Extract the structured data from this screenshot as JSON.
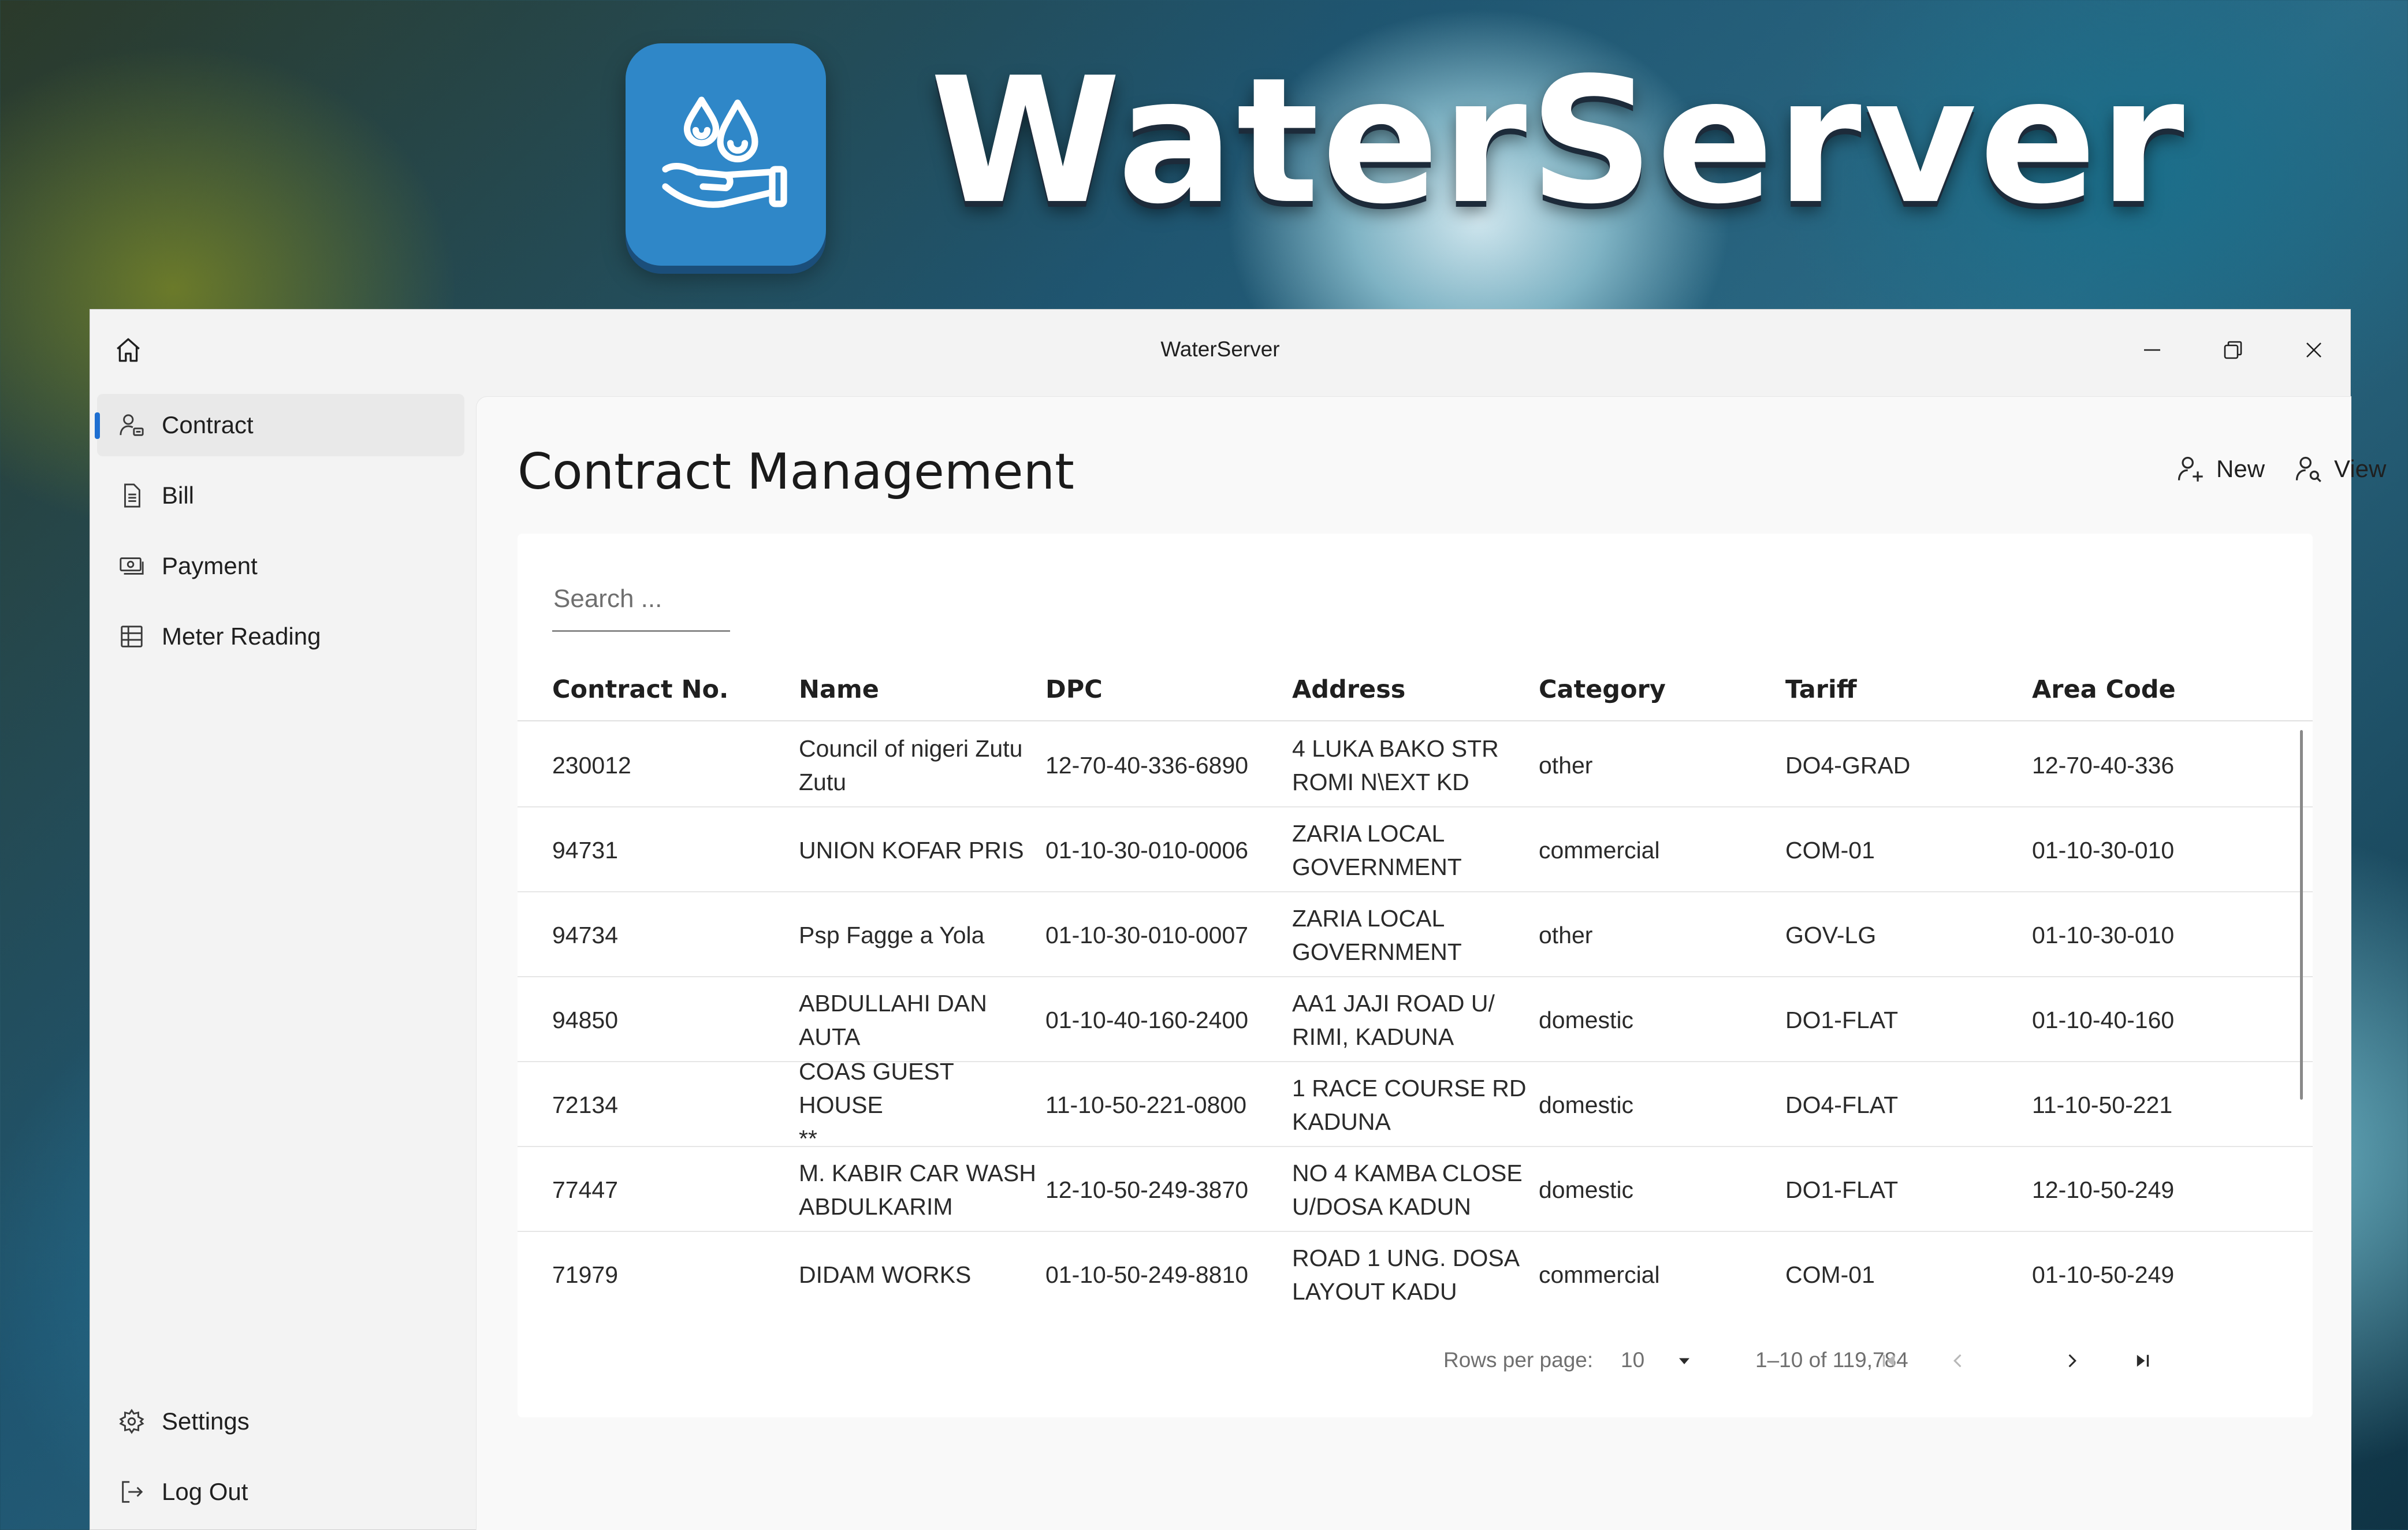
{
  "brand": {
    "name": "WaterServer",
    "logo_icon": "water-hand-icon",
    "logo_color": "#2f87c8"
  },
  "window": {
    "title": "WaterServer",
    "controls": [
      "minimize-icon",
      "restore-icon",
      "close-icon"
    ]
  },
  "sidebar": {
    "top_items": [
      {
        "label": "Contract",
        "icon": "contract-person-icon",
        "active": true
      },
      {
        "label": "Bill",
        "icon": "bill-document-icon",
        "active": false
      },
      {
        "label": "Payment",
        "icon": "payment-cash-icon",
        "active": false
      },
      {
        "label": "Meter Reading",
        "icon": "meter-table-icon",
        "active": false
      }
    ],
    "bottom_items": [
      {
        "label": "Settings",
        "icon": "gear-icon"
      },
      {
        "label": "Log Out",
        "icon": "logout-icon"
      }
    ],
    "accent": "#1f6fd1"
  },
  "main": {
    "title": "Contract Management",
    "actions": {
      "new_label": "New",
      "view_label": "View"
    },
    "search": {
      "placeholder": "Search ..."
    },
    "table": {
      "columns": [
        "Contract No.",
        "Name",
        "DPC",
        "Address",
        "Category",
        "Tariff",
        "Area Code"
      ],
      "rows": [
        {
          "contract_no": "230012",
          "name": [
            "Council of nigeri Zutu",
            "Zutu"
          ],
          "dpc": "12-70-40-336-6890",
          "address": [
            "4 LUKA BAKO STR",
            "ROMI N\\EXT KD"
          ],
          "category": "other",
          "tariff": "DO4-GRAD",
          "area_code": "12-70-40-336"
        },
        {
          "contract_no": "94731",
          "name": [
            "UNION KOFAR PRIS"
          ],
          "dpc": "01-10-30-010-0006",
          "address": [
            "ZARIA LOCAL",
            "GOVERNMENT"
          ],
          "category": "commercial",
          "tariff": "COM-01",
          "area_code": "01-10-30-010"
        },
        {
          "contract_no": "94734",
          "name": [
            "Psp Fagge a Yola"
          ],
          "dpc": "01-10-30-010-0007",
          "address": [
            "ZARIA LOCAL",
            "GOVERNMENT"
          ],
          "category": "other",
          "tariff": "GOV-LG",
          "area_code": "01-10-30-010"
        },
        {
          "contract_no": "94850",
          "name": [
            "ABDULLAHI DAN",
            "AUTA"
          ],
          "dpc": "01-10-40-160-2400",
          "address": [
            "AA1 JAJI ROAD U/",
            "RIMI, KADUNA"
          ],
          "category": "domestic",
          "tariff": "DO1-FLAT",
          "area_code": "01-10-40-160"
        },
        {
          "contract_no": "72134",
          "name": [
            "COAS GUEST HOUSE",
            "**"
          ],
          "dpc": "11-10-50-221-0800",
          "address": [
            "1 RACE COURSE  RD",
            "KADUNA"
          ],
          "category": "domestic",
          "tariff": "DO4-FLAT",
          "area_code": "11-10-50-221"
        },
        {
          "contract_no": "77447",
          "name": [
            "M.  KABIR CAR WASH",
            "ABDULKARIM"
          ],
          "dpc": "12-10-50-249-3870",
          "address": [
            "NO 4 KAMBA CLOSE",
            "U/DOSA KADUN"
          ],
          "category": "domestic",
          "tariff": "DO1-FLAT",
          "area_code": "12-10-50-249"
        },
        {
          "contract_no": "71979",
          "name": [
            "DIDAM WORKS"
          ],
          "dpc": "01-10-50-249-8810",
          "address": [
            "ROAD 1 UNG. DOSA",
            "LAYOUT KADU"
          ],
          "category": "commercial",
          "tariff": "COM-01",
          "area_code": "01-10-50-249"
        }
      ]
    },
    "pagination": {
      "rows_per_page_label": "Rows per page:",
      "rows_per_page_value": "10",
      "range_text": "1–10 of 119,784"
    }
  }
}
